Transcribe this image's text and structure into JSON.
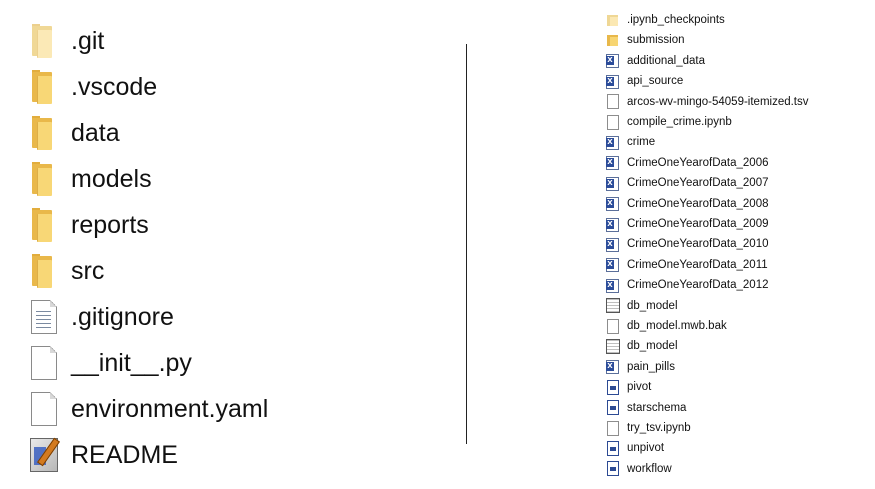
{
  "left_items": [
    {
      "label": ".git",
      "type": "folder-dim"
    },
    {
      "label": ".vscode",
      "type": "folder"
    },
    {
      "label": "data",
      "type": "folder"
    },
    {
      "label": "models",
      "type": "folder"
    },
    {
      "label": "reports",
      "type": "folder"
    },
    {
      "label": "src",
      "type": "folder"
    },
    {
      "label": ".gitignore",
      "type": "text-doc"
    },
    {
      "label": "__init__.py",
      "type": "blank-doc"
    },
    {
      "label": "environment.yaml",
      "type": "blank-doc"
    },
    {
      "label": "README",
      "type": "readme"
    }
  ],
  "right_items": [
    {
      "label": ".ipynb_checkpoints",
      "type": "folder-dim"
    },
    {
      "label": "submission",
      "type": "folder"
    },
    {
      "label": "additional_data",
      "type": "excel"
    },
    {
      "label": "api_source",
      "type": "excel"
    },
    {
      "label": "arcos-wv-mingo-54059-itemized.tsv",
      "type": "doc"
    },
    {
      "label": "compile_crime.ipynb",
      "type": "doc"
    },
    {
      "label": "crime",
      "type": "excel"
    },
    {
      "label": "CrimeOneYearofData_2006",
      "type": "excel"
    },
    {
      "label": "CrimeOneYearofData_2007",
      "type": "excel"
    },
    {
      "label": "CrimeOneYearofData_2008",
      "type": "excel"
    },
    {
      "label": "CrimeOneYearofData_2009",
      "type": "excel"
    },
    {
      "label": "CrimeOneYearofData_2010",
      "type": "excel"
    },
    {
      "label": "CrimeOneYearofData_2011",
      "type": "excel"
    },
    {
      "label": "CrimeOneYearofData_2012",
      "type": "excel"
    },
    {
      "label": "db_model",
      "type": "db"
    },
    {
      "label": "db_model.mwb.bak",
      "type": "doc"
    },
    {
      "label": "db_model",
      "type": "db"
    },
    {
      "label": "pain_pills",
      "type": "excel"
    },
    {
      "label": "pivot",
      "type": "ppt"
    },
    {
      "label": "starschema",
      "type": "ppt"
    },
    {
      "label": "try_tsv.ipynb",
      "type": "doc"
    },
    {
      "label": "unpivot",
      "type": "ppt"
    },
    {
      "label": "workflow",
      "type": "ppt"
    }
  ]
}
